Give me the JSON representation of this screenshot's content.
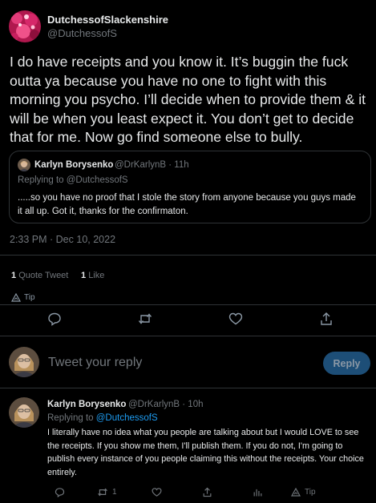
{
  "tweet": {
    "display_name": "DutchessofSlackenshire",
    "handle": "@DutchessofS",
    "text": "I do have receipts and you know it.  It’s buggin the fuck outta ya because you have no one to fight with this morning you psycho.  I’ll decide when to provide them & it will be when you least expect it.  You don’t get to decide that for me.  Now go find someone else to bully.",
    "timestamp": "2:33 PM · Dec 10, 2022",
    "quote_tweets_count": "1",
    "quote_tweets_label": "Quote Tweet",
    "likes_count": "1",
    "likes_label": "Like",
    "tip_label": "Tip"
  },
  "quoted": {
    "display_name": "Karlyn Borysenko",
    "meta": "@DrKarlynB · 11h",
    "replying_to": "Replying to @DutchessofS",
    "text": ".....so you have no proof that I stole the story from anyone  because you guys made it all up. Got it, thanks for the confirmaton."
  },
  "composer": {
    "placeholder": "Tweet your reply",
    "reply_button": "Reply"
  },
  "reply": {
    "display_name": "Karlyn Borysenko",
    "meta": "@DrKarlynB · 10h",
    "replying_prefix": "Replying to",
    "replying_handle": "@DutchessofS",
    "text": "I literally have no idea what you people are talking about but I would LOVE to see the receipts. If you show me them, I'll publish them. If you do not, I'm going to publish every instance of you people claiming this without the receipts. Your choice entirely.",
    "retweet_count": "1",
    "tip_label": "Tip"
  },
  "colors": {
    "background": "#000000",
    "text": "#e7e9ea",
    "muted": "#71767b",
    "accent": "#1d9bf0",
    "border": "#2f3336",
    "reply_button_bg": "#1d4e77"
  }
}
